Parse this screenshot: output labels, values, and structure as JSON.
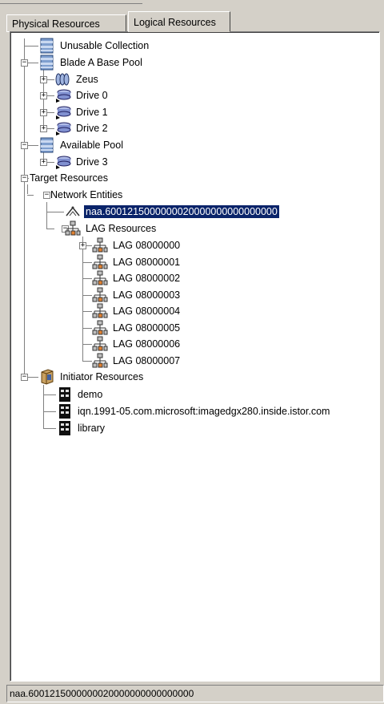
{
  "tabs": {
    "physical": "Physical Resources",
    "logical": "Logical Resources"
  },
  "tree": {
    "unusable_collection": "Unusable Collection",
    "blade_a_base_pool": "Blade A Base Pool",
    "zeus": "Zeus",
    "drive0": "Drive 0",
    "drive1": "Drive 1",
    "drive2": "Drive 2",
    "available_pool": "Available Pool",
    "drive3": "Drive 3",
    "target_resources": "Target Resources",
    "network_entities": "Network Entities",
    "naa": "naa.6001215000000020000000000000000",
    "lag_resources": "LAG Resources",
    "lags": [
      "LAG 08000000",
      "LAG 08000001",
      "LAG 08000002",
      "LAG 08000003",
      "LAG 08000004",
      "LAG 08000005",
      "LAG 08000006",
      "LAG 08000007"
    ],
    "initiator_resources": "Initiator Resources",
    "demo": "demo",
    "iqn": "iqn.1991-05.com.microsoft:imagedgx280.inside.istor.com",
    "library": "library"
  },
  "status_bar": "naa.6001215000000020000000000000000",
  "colors": {
    "selection": "#0a246a",
    "panel": "#d4d0c8",
    "tree_bg": "#ffffff"
  },
  "icons": {
    "pool": "storage-pool-icon",
    "drive": "disk-drive-icon",
    "zeus": "volume-group-icon",
    "network_entity": "network-target-icon",
    "lag": "lag-network-icon",
    "initiator_group": "initiator-cabinet-icon",
    "initiator": "initiator-host-icon"
  }
}
